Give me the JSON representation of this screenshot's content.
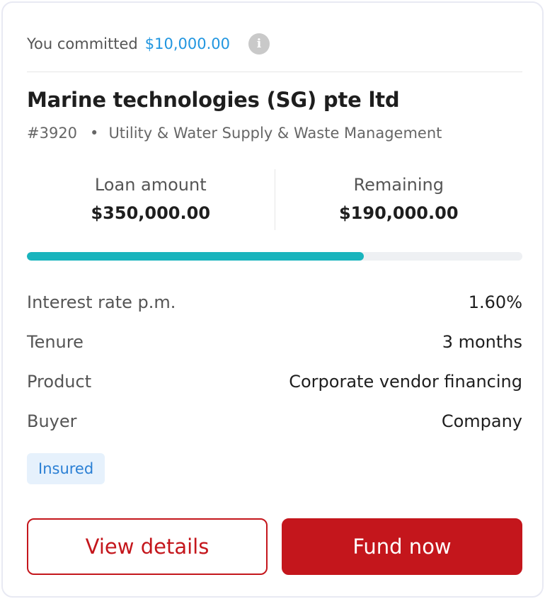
{
  "commitment": {
    "label": "You committed",
    "amount": "$10,000.00",
    "info_icon": "info-icon"
  },
  "company": {
    "name": "Marine technologies (SG) pte ltd",
    "id": "#3920",
    "separator": "•",
    "industry": "Utility & Water Supply & Waste Management"
  },
  "stats": {
    "loan_amount": {
      "label": "Loan amount",
      "value": "$350,000.00"
    },
    "remaining": {
      "label": "Remaining",
      "value": "$190,000.00"
    }
  },
  "progress": {
    "funded_fraction": 0.68,
    "fill_color": "#19b4bd",
    "track_color": "#eef0f3"
  },
  "details": [
    {
      "label": "Interest rate p.m.",
      "value": "1.60%"
    },
    {
      "label": "Tenure",
      "value": "3 months"
    },
    {
      "label": "Product",
      "value": "Corporate vendor financing"
    },
    {
      "label": "Buyer",
      "value": "Company"
    }
  ],
  "badge": {
    "label": "Insured"
  },
  "actions": {
    "view_details": "View details",
    "fund_now": "Fund now"
  },
  "colors": {
    "brand_red": "#c4161c",
    "link_blue": "#2196e0",
    "badge_bg": "#e6f1fc",
    "badge_text": "#2a7fd4"
  }
}
